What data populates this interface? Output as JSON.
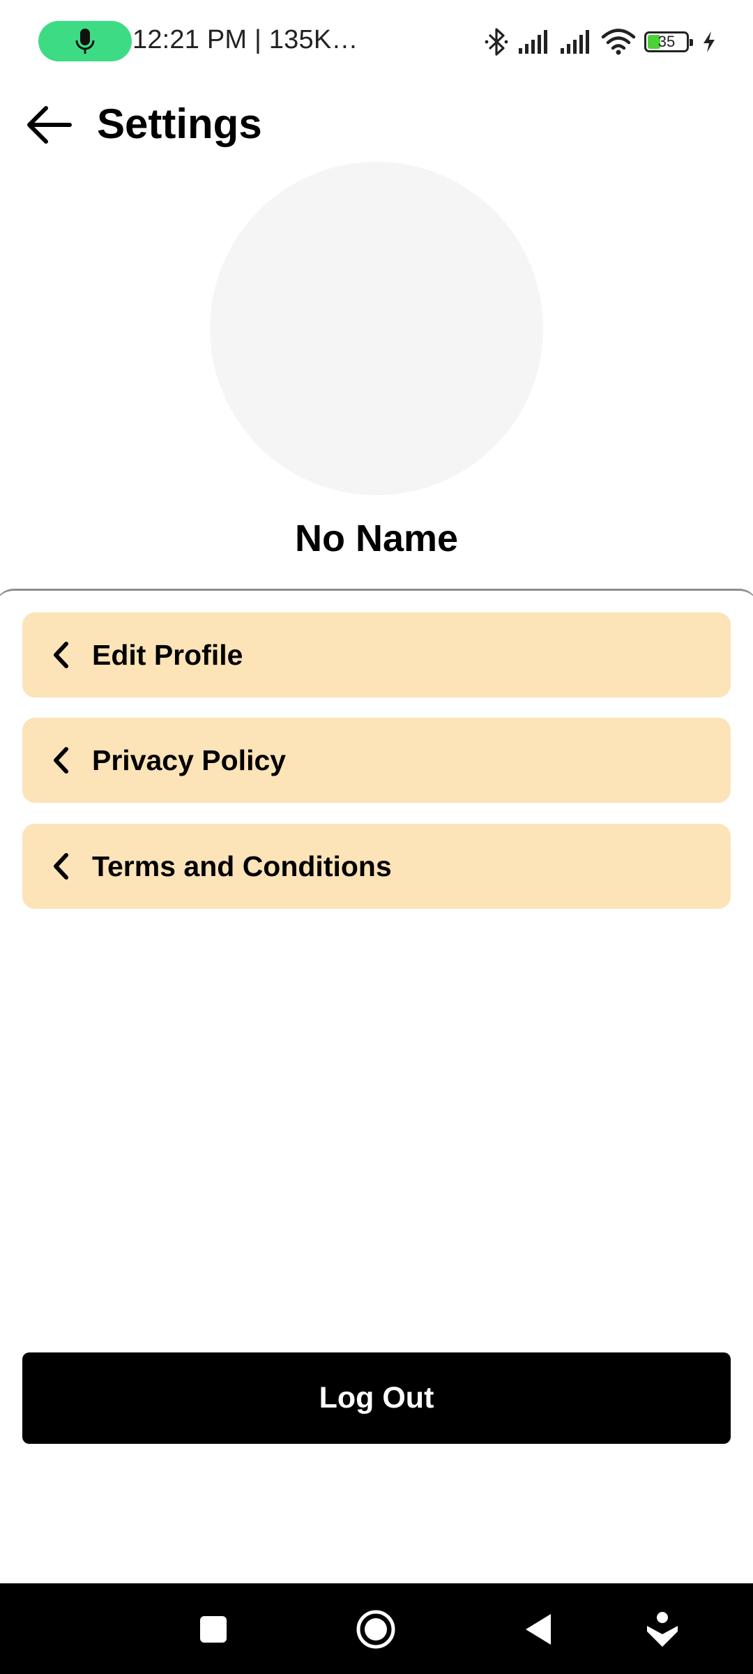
{
  "status_bar": {
    "text": "12:21 PM | 135K…",
    "battery_level": "35",
    "icons": [
      "microphone-icon",
      "bluetooth-icon",
      "signal-icon",
      "signal-icon",
      "wifi-icon",
      "battery-icon",
      "charging-icon"
    ]
  },
  "header": {
    "title": "Settings",
    "back_icon": "arrow-left-icon"
  },
  "profile": {
    "name": "No Name"
  },
  "menu": {
    "items": [
      {
        "label": "Edit Profile",
        "icon": "chevron-left-icon"
      },
      {
        "label": "Privacy Policy",
        "icon": "chevron-left-icon"
      },
      {
        "label": "Terms and Conditions",
        "icon": "chevron-left-icon"
      }
    ]
  },
  "logout": {
    "label": "Log Out"
  },
  "nav_bar": {
    "icons": [
      "recents-icon",
      "home-icon",
      "back-icon",
      "assistant-icon"
    ]
  },
  "colors": {
    "accent_pill": "#3ddc84",
    "menu_item_bg": "#fce3b8",
    "avatar_bg": "#f5f5f5",
    "logout_bg": "#000000"
  }
}
